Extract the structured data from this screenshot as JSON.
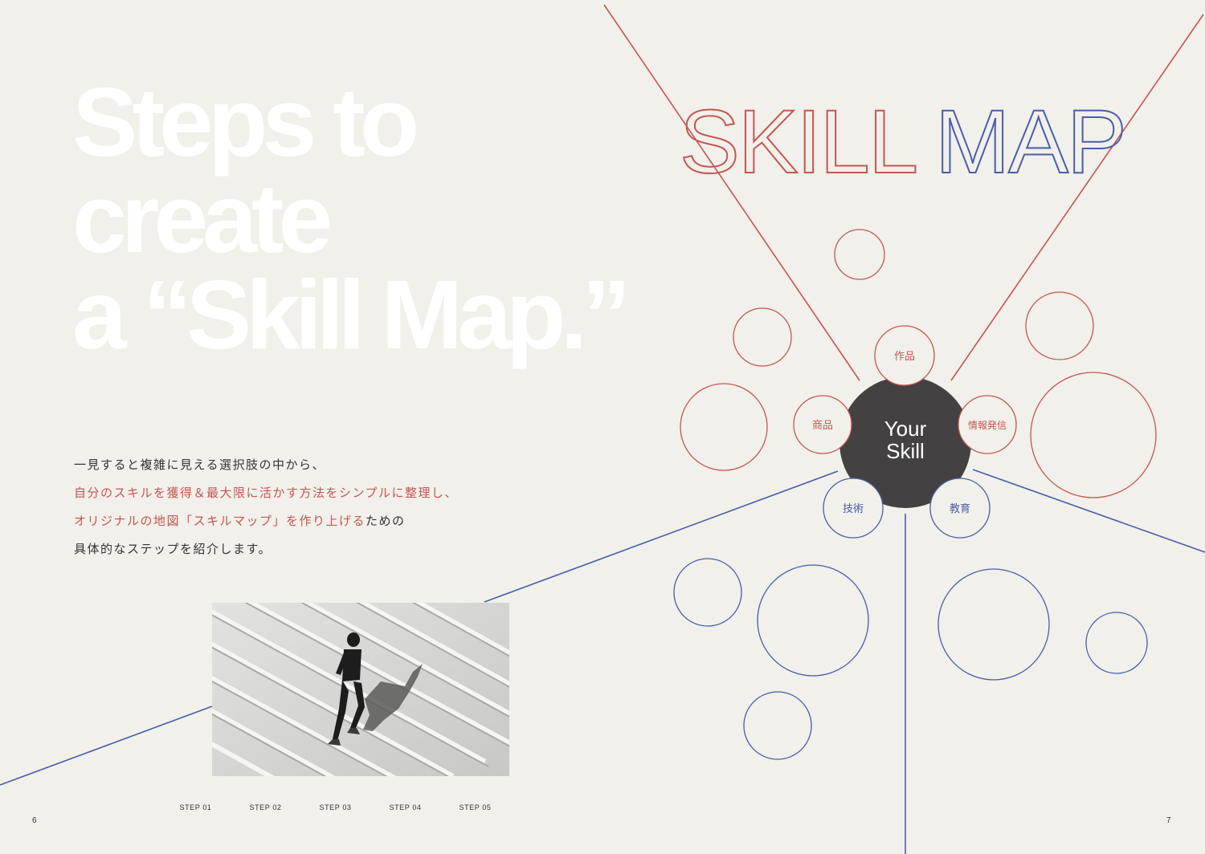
{
  "headline": {
    "line1": "Steps to",
    "line2": "create",
    "line3": "a “Skill Map.”"
  },
  "intro": {
    "line1": "一見すると複雑に見える選択肢の中から、",
    "line2": "自分のスキルを獲得＆最大限に活かす方法をシンプルに整理し、",
    "line3_highlight": "オリジナルの地図「スキルマップ」を作り上げる",
    "line3_rest": "ための",
    "line4": "具体的なステップを紹介します。"
  },
  "skill_map": {
    "title_part1": "SKILL",
    "title_part2": "MAP",
    "center_line1": "Your",
    "center_line2": "Skill",
    "nodes": {
      "works": "作品",
      "products": "商品",
      "publishing": "情報発信",
      "technology": "技術",
      "education": "教育"
    }
  },
  "steps": [
    "STEP 01",
    "STEP 02",
    "STEP 03",
    "STEP 04",
    "STEP 05"
  ],
  "page_numbers": {
    "left": "6",
    "right": "7"
  },
  "photo": {
    "icon": "person-climbing-stairs-photo"
  },
  "colors": {
    "background": "#f1f0eb",
    "red": "#c55650",
    "blue": "#4a5ea8",
    "center": "#434141",
    "white": "#ffffff"
  }
}
